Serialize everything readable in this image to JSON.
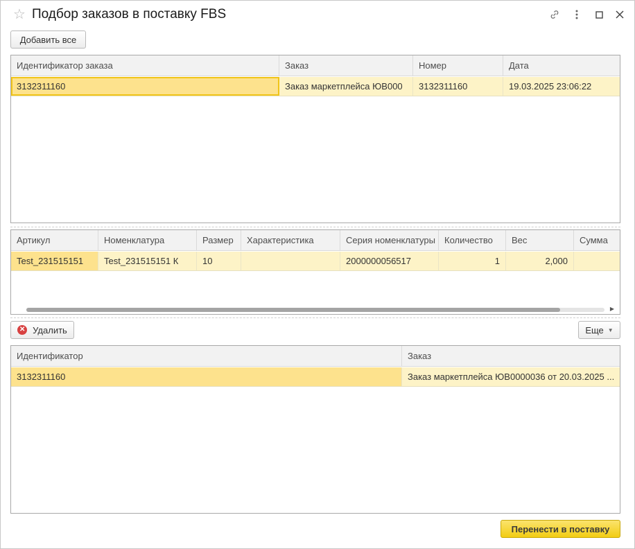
{
  "window": {
    "title": "Подбор заказов в поставку FBS",
    "icons": [
      "star-icon",
      "link-icon",
      "more-vert-icon",
      "maximize-icon",
      "close-icon"
    ]
  },
  "toolbar": {
    "add_all_label": "Добавить все"
  },
  "orders_table": {
    "columns": [
      "Идентификатор заказа",
      "Заказ",
      "Номер",
      "Дата"
    ],
    "rows": [
      {
        "id": "3132311160",
        "order": "Заказ маркетплейса ЮВ000",
        "number": "3132311160",
        "date": "19.03.2025 23:06:22"
      }
    ]
  },
  "items_table": {
    "columns": [
      "Артикул",
      "Номенклатура",
      "Размер",
      "Характеристика",
      "Серия номенклатуры",
      "Количество",
      "Вес",
      "Сумма"
    ],
    "rows": [
      {
        "article": "Test_231515151",
        "nomenclature": "Test_231515151 К",
        "size": "10",
        "characteristic": "",
        "series": "2000000056517",
        "quantity": "1",
        "weight": "2,000",
        "sum": ""
      }
    ]
  },
  "bottom_toolbar": {
    "delete_label": "Удалить",
    "more_label": "Еще"
  },
  "selected_table": {
    "columns": [
      "Идентификатор",
      "Заказ"
    ],
    "rows": [
      {
        "id": "3132311160",
        "order": "Заказ маркетплейса ЮВ0000036 от 20.03.2025 ..."
      }
    ]
  },
  "footer": {
    "transfer_label": "Перенести в поставку"
  },
  "colors": {
    "accent": "#f2cd13",
    "row_selected": "#fdf3c7",
    "cell_active": "#fde28d",
    "delete_icon": "#d84141"
  }
}
